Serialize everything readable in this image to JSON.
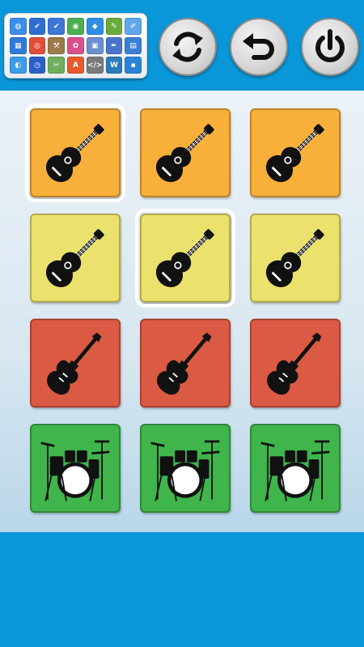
{
  "colors": {
    "background": "#0a97d9",
    "board": "#dce9f1",
    "tile_orange": "#f9b03a",
    "tile_yellow": "#ebe26d",
    "tile_red": "#db5a43",
    "tile_green": "#3fb54c"
  },
  "launcher": {
    "apps": [
      {
        "icon": "globe-icon",
        "color": "#3a8ee6",
        "glyph": "◍"
      },
      {
        "icon": "checkbox-icon",
        "color": "#2d6fd1",
        "glyph": "✔"
      },
      {
        "icon": "checkbox-blue-icon",
        "color": "#3c77d6",
        "glyph": "✔"
      },
      {
        "icon": "eye-icon",
        "color": "#4caf50",
        "glyph": "◉"
      },
      {
        "icon": "dropbox-icon",
        "color": "#2f8de4",
        "glyph": "◆"
      },
      {
        "icon": "evernote-icon",
        "color": "#6aab3c",
        "glyph": "✎"
      },
      {
        "icon": "pen-icon",
        "color": "#5fa8e8",
        "glyph": "✐"
      },
      {
        "icon": "calendar-icon",
        "color": "#2e7bd9",
        "glyph": "▦"
      },
      {
        "icon": "chrome-icon",
        "color": "#e04e39",
        "glyph": "◎"
      },
      {
        "icon": "tools-icon",
        "color": "#9c7a4a",
        "glyph": "⚒"
      },
      {
        "icon": "palette-icon",
        "color": "#d94f8c",
        "glyph": "✿"
      },
      {
        "icon": "photo-icon",
        "color": "#6b8fd1",
        "glyph": "▣"
      },
      {
        "icon": "feather-icon",
        "color": "#4a74c9",
        "glyph": "✒"
      },
      {
        "icon": "grid-app-icon",
        "color": "#3a7fd5",
        "glyph": "▤"
      },
      {
        "icon": "internet-icon",
        "color": "#3e9be8",
        "glyph": "◐"
      },
      {
        "icon": "stopwatch-icon",
        "color": "#2d5fc7",
        "glyph": "◷"
      },
      {
        "icon": "scissors-icon",
        "color": "#6fae5a",
        "glyph": "✂"
      },
      {
        "icon": "text-icon",
        "color": "#e85a2c",
        "glyph": "A"
      },
      {
        "icon": "code-icon",
        "color": "#7a7a7a",
        "glyph": "</>"
      },
      {
        "icon": "wordpress-icon",
        "color": "#2b7bb9",
        "glyph": "W"
      },
      {
        "icon": "windows-icon",
        "color": "#2a83d6",
        "glyph": "▪"
      }
    ]
  },
  "controls": [
    {
      "name": "refresh-button",
      "icon": "refresh-icon"
    },
    {
      "name": "undo-button",
      "icon": "undo-icon"
    },
    {
      "name": "power-button",
      "icon": "power-icon"
    }
  ],
  "tiles": [
    {
      "row": 0,
      "col": 0,
      "instrument": "acoustic-guitar",
      "color": "#f9b03a",
      "selected": true
    },
    {
      "row": 0,
      "col": 1,
      "instrument": "acoustic-guitar",
      "color": "#f9b03a",
      "selected": false
    },
    {
      "row": 0,
      "col": 2,
      "instrument": "acoustic-guitar",
      "color": "#f9b03a",
      "selected": false
    },
    {
      "row": 1,
      "col": 0,
      "instrument": "acoustic-guitar",
      "color": "#ebe26d",
      "selected": false
    },
    {
      "row": 1,
      "col": 1,
      "instrument": "acoustic-guitar",
      "color": "#ebe26d",
      "selected": true
    },
    {
      "row": 1,
      "col": 2,
      "instrument": "acoustic-guitar",
      "color": "#ebe26d",
      "selected": false
    },
    {
      "row": 2,
      "col": 0,
      "instrument": "electric-guitar",
      "color": "#db5a43",
      "selected": false
    },
    {
      "row": 2,
      "col": 1,
      "instrument": "electric-guitar",
      "color": "#db5a43",
      "selected": false
    },
    {
      "row": 2,
      "col": 2,
      "instrument": "electric-guitar",
      "color": "#db5a43",
      "selected": false
    },
    {
      "row": 3,
      "col": 0,
      "instrument": "drum-kit",
      "color": "#3fb54c",
      "selected": false
    },
    {
      "row": 3,
      "col": 1,
      "instrument": "drum-kit",
      "color": "#3fb54c",
      "selected": false
    },
    {
      "row": 3,
      "col": 2,
      "instrument": "drum-kit",
      "color": "#3fb54c",
      "selected": false
    }
  ]
}
